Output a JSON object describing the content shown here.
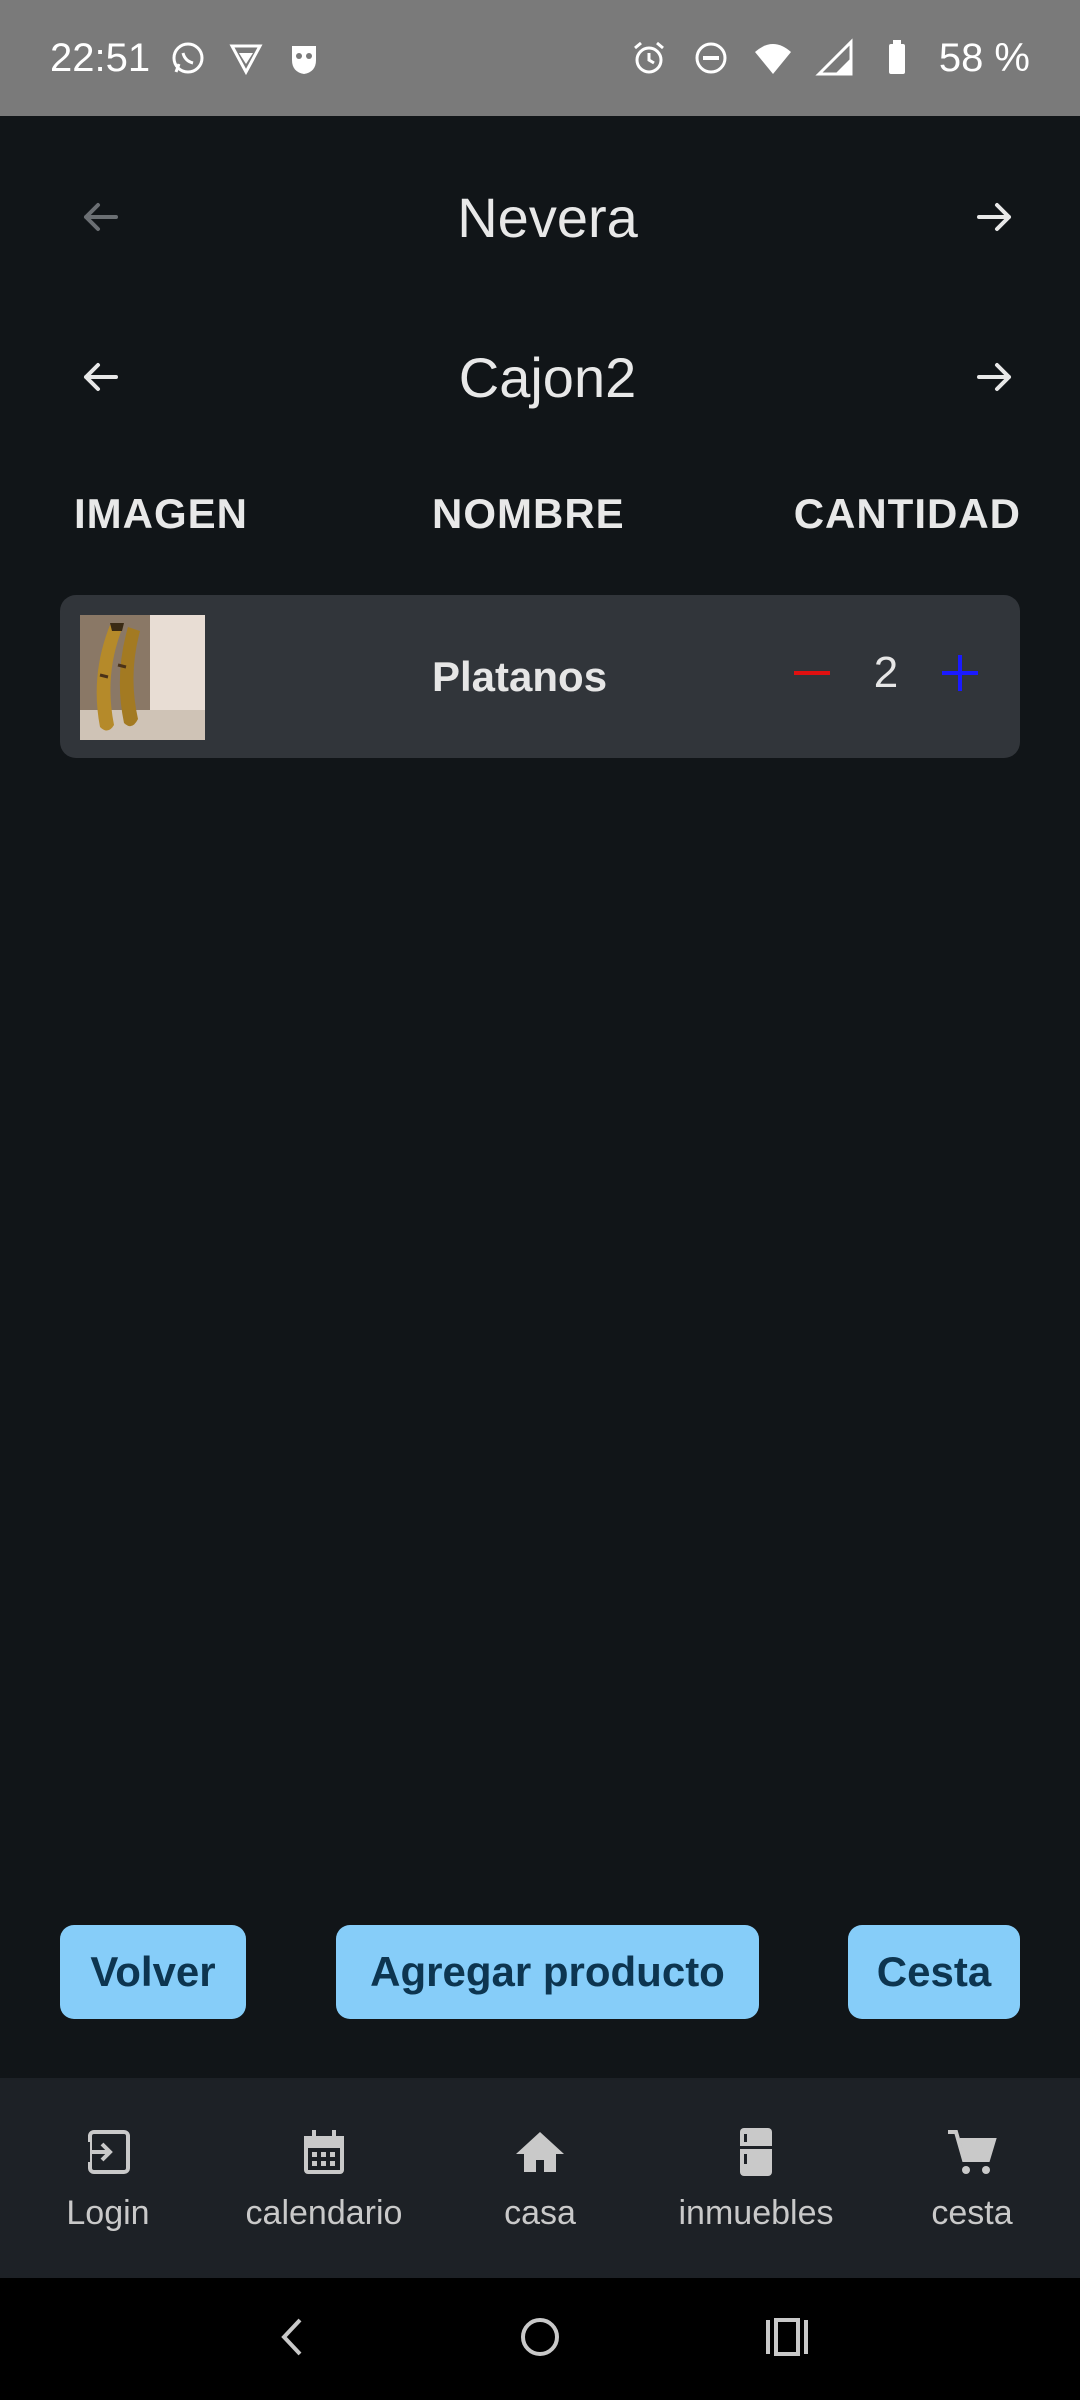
{
  "status_bar": {
    "time": "22:51",
    "battery": "58 %",
    "left_icons": [
      "whatsapp-icon",
      "vpn-shield-icon",
      "mask-icon"
    ],
    "right_icons": [
      "alarm-icon",
      "dnd-icon",
      "wifi-icon",
      "signal-icon",
      "battery-icon"
    ]
  },
  "location": {
    "title": "Nevera",
    "prev_icon": "arrow-left-icon",
    "next_icon": "arrow-right-icon"
  },
  "drawer": {
    "title": "Cajon2",
    "prev_icon": "arrow-left-icon",
    "next_icon": "arrow-right-icon"
  },
  "columns": {
    "image": "IMAGEN",
    "name": "NOMBRE",
    "quantity": "CANTIDAD"
  },
  "products": [
    {
      "name": "Platanos",
      "quantity": "2",
      "image": "bananas-photo"
    }
  ],
  "actions": {
    "back": "Volver",
    "add_product": "Agregar producto",
    "basket": "Cesta"
  },
  "bottom_nav": [
    {
      "label": "Login",
      "icon": "login-icon"
    },
    {
      "label": "calendario",
      "icon": "calendar-icon"
    },
    {
      "label": "casa",
      "icon": "home-icon"
    },
    {
      "label": "inmuebles",
      "icon": "fridge-icon"
    },
    {
      "label": "cesta",
      "icon": "cart-icon"
    }
  ],
  "colors": {
    "background": "#111518",
    "card": "#31353a",
    "button": "#86cdf9",
    "button_text": "#0d3550",
    "minus": "#e01010",
    "plus": "#1a1aff",
    "nav_bar": "#1d2126"
  }
}
